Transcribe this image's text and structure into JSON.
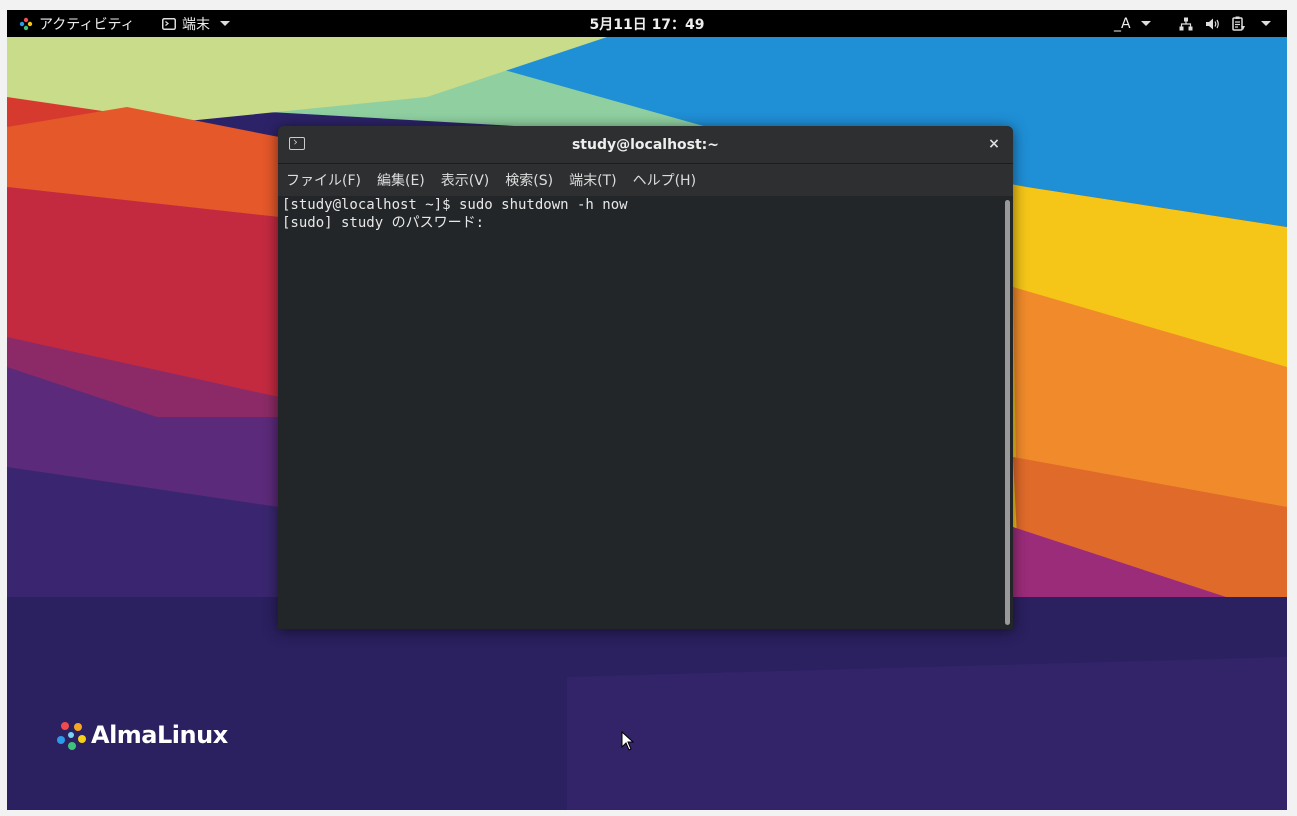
{
  "topbar": {
    "activities_label": "アクティビティ",
    "app_menu_label": "端末",
    "clock": "5月11日  17：49",
    "input_method": "_A"
  },
  "terminal": {
    "title": "study@localhost:~",
    "close_glyph": "×",
    "menu": [
      "ファイル(F)",
      "編集(E)",
      "表示(V)",
      "検索(S)",
      "端末(T)",
      "ヘルプ(H)"
    ],
    "lines": [
      "[study@localhost ~]$ sudo shutdown -h now",
      "[sudo] study のパスワード:"
    ]
  },
  "desktop": {
    "logo_text": "AlmaLinux"
  },
  "icons": {
    "activities": "almalinux-logo-icon",
    "app_menu": "terminal-icon",
    "network": "network-wired-icon",
    "volume": "volume-icon",
    "power": "battery-clipboard-icon"
  }
}
